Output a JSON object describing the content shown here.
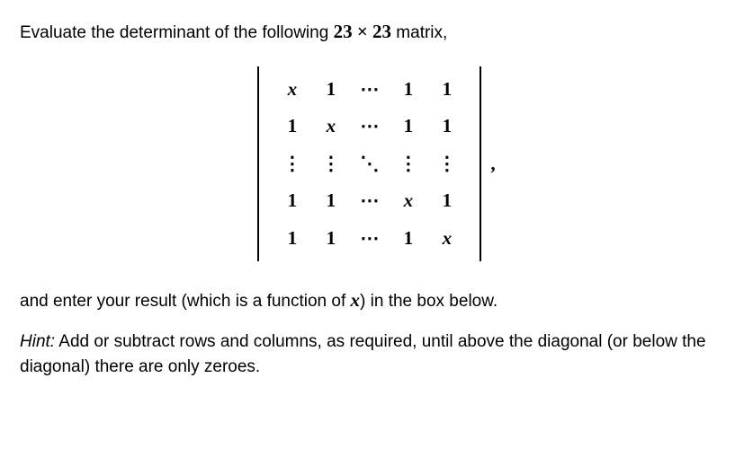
{
  "question": {
    "intro_prefix": "Evaluate the determinant of the following ",
    "dimension": "23 × 23",
    "intro_suffix": " matrix,",
    "after_matrix_prefix": "and enter your result (which is a function of ",
    "variable": "x",
    "after_matrix_suffix": ") in the box below.",
    "hint_label": "Hint:",
    "hint_text": " Add or subtract rows and columns, as required, until above the diagonal (or below the diagonal) there are only zeroes."
  },
  "matrix": {
    "rows": [
      [
        "x",
        "1",
        "⋯",
        "1",
        "1"
      ],
      [
        "1",
        "x",
        "⋯",
        "1",
        "1"
      ],
      [
        "⋮",
        "⋮",
        "⋱",
        "⋮",
        "⋮"
      ],
      [
        "1",
        "1",
        "⋯",
        "x",
        "1"
      ],
      [
        "1",
        "1",
        "⋯",
        "1",
        "x"
      ]
    ],
    "trailing": ","
  }
}
